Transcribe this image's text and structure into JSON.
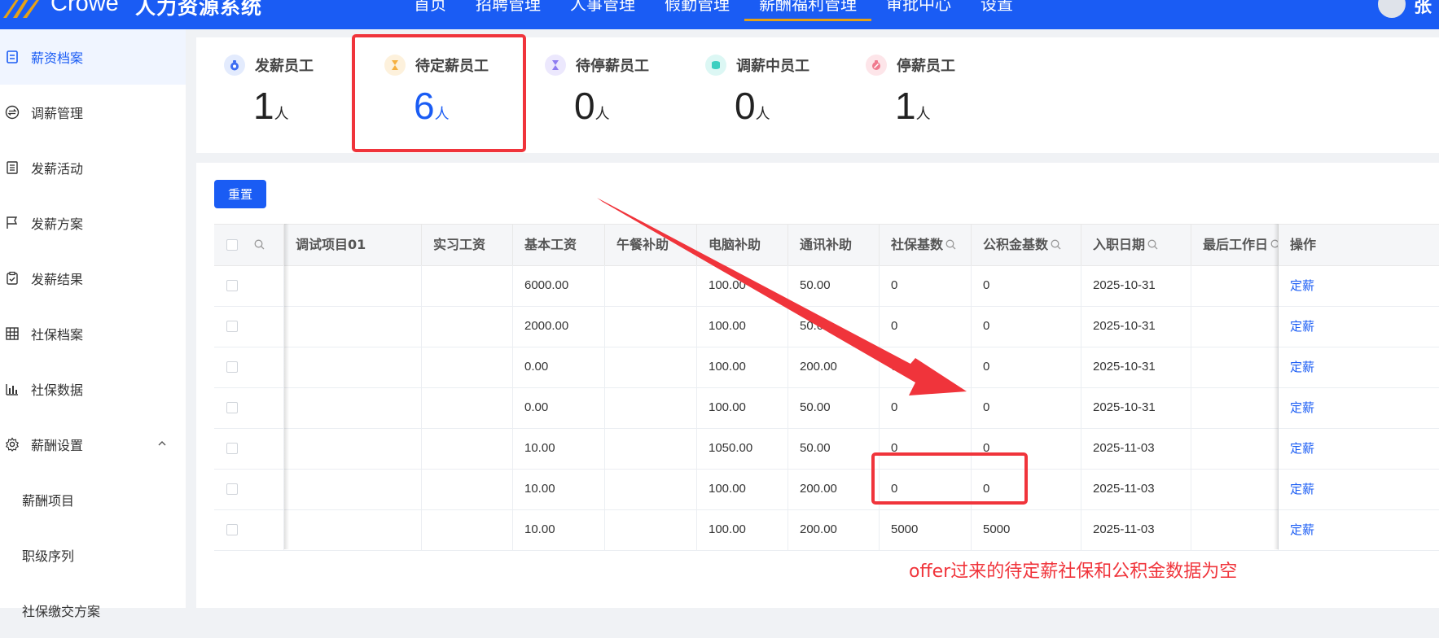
{
  "header": {
    "brand": "Crowe",
    "system_name": "人力资源系统",
    "nav": [
      "首页",
      "招聘管理",
      "人事管理",
      "假勤管理",
      "薪酬福利管理",
      "审批中心",
      "设置"
    ],
    "active_nav": 4,
    "user_name": "张"
  },
  "sidebar": {
    "items": [
      {
        "label": "薪资档案",
        "icon": "document-icon"
      },
      {
        "label": "调薪管理",
        "icon": "exchange-icon"
      },
      {
        "label": "发薪活动",
        "icon": "list-icon"
      },
      {
        "label": "发薪方案",
        "icon": "flag-icon"
      },
      {
        "label": "发薪结果",
        "icon": "clipboard-check-icon"
      },
      {
        "label": "社保档案",
        "icon": "building-icon"
      },
      {
        "label": "社保数据",
        "icon": "bar-chart-icon"
      },
      {
        "label": "薪酬设置",
        "icon": "gear-icon"
      }
    ],
    "submenu": [
      "薪酬项目",
      "职级序列",
      "社保缴交方案"
    ]
  },
  "stats": [
    {
      "label": "发薪员工",
      "value": "1",
      "unit": "人",
      "color": "#3d6df2"
    },
    {
      "label": "待定薪员工",
      "value": "6",
      "unit": "人",
      "color": "#f5b041"
    },
    {
      "label": "待停薪员工",
      "value": "0",
      "unit": "人",
      "color": "#8e7cf0"
    },
    {
      "label": "调薪中员工",
      "value": "0",
      "unit": "人",
      "color": "#3ccfc0"
    },
    {
      "label": "停薪员工",
      "value": "1",
      "unit": "人",
      "color": "#f07a8e"
    }
  ],
  "toolbar": {
    "reset_label": "重置"
  },
  "table": {
    "columns": [
      "",
      "调试项目01",
      "实习工资",
      "基本工资",
      "午餐补助",
      "电脑补助",
      "通讯补助",
      "社保基数",
      "公积金基数",
      "入职日期",
      "最后工作日",
      "操作"
    ],
    "rows": [
      [
        "",
        "",
        "",
        "6000.00",
        "",
        "100.00",
        "50.00",
        "0",
        "0",
        "2025-10-31",
        "",
        "定薪"
      ],
      [
        "",
        "",
        "",
        "2000.00",
        "",
        "100.00",
        "50.00",
        "0",
        "0",
        "2025-10-31",
        "",
        "定薪"
      ],
      [
        "",
        "",
        "",
        "0.00",
        "",
        "100.00",
        "200.00",
        "0",
        "0",
        "2025-10-31",
        "",
        "定薪"
      ],
      [
        "",
        "",
        "",
        "0.00",
        "",
        "100.00",
        "50.00",
        "0",
        "0",
        "2025-10-31",
        "",
        "定薪"
      ],
      [
        "",
        "",
        "",
        "10.00",
        "",
        "1050.00",
        "50.00",
        "0",
        "0",
        "2025-11-03",
        "",
        "定薪"
      ],
      [
        "",
        "",
        "",
        "10.00",
        "",
        "100.00",
        "200.00",
        "0",
        "0",
        "2025-11-03",
        "",
        "定薪"
      ],
      [
        "",
        "",
        "",
        "10.00",
        "",
        "100.00",
        "200.00",
        "5000",
        "5000",
        "2025-11-03",
        "",
        "定薪"
      ]
    ]
  },
  "annotation": {
    "text": "offer过来的待定薪社保和公积金数据为空",
    "color": "#f0343b"
  }
}
